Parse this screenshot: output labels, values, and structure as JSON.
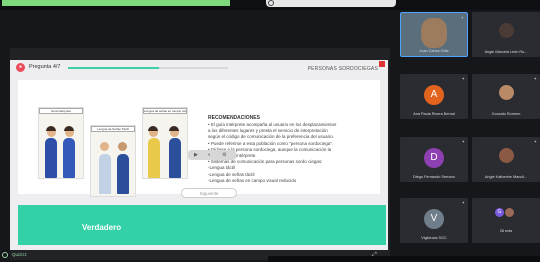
{
  "quiz": {
    "progress_label": "Pregunta 4/7",
    "progress_fraction": 0.571,
    "section_title": "PERSONAS SORDOCIEGAS",
    "answer_label": "Verdadero",
    "next_button": "Siguiente",
    "images": [
      {
        "caption": "Guía intérprete"
      },
      {
        "caption": "Lengua de Señas Táctil"
      },
      {
        "caption": "Lengua de señas en campo visual reducido"
      }
    ],
    "recommendations_title": "RECOMENDACIONES",
    "recommendations": [
      "• El guía intérprete acompaña al usuario en los desplazamientos",
      "  a los diferentes lugares y presta el servicio de interpretación",
      "  según el código de comunicación de la preferencia del usuario.",
      "• Puede referirse a esta población como \"persona sordociega\".",
      "• Diríjase a la persona sordociega, aunque la comunicación la",
      "  medie el guía intérprete.",
      "• Sistemas de comunicación para personas sordo ciegas:",
      "  -Lengua táctil",
      "  -Lengua de señas táctil",
      "  -Lengua de señas en campo visual reducido"
    ],
    "brand": "Quizizz",
    "accent": "#34d0a7",
    "pill_icon": "record-icon"
  },
  "participants": [
    {
      "name": "Juan Carlos Ortiz",
      "avatar": "photo",
      "speaker": true
    },
    {
      "name": "Angie Marcela León Ru...",
      "avatar": "photo"
    },
    {
      "name": "Ana Paola Rivera Bernal",
      "initial": "A",
      "color": "#e2631e"
    },
    {
      "name": "Gonzalo Romero",
      "avatar": "photo"
    },
    {
      "name": "Diego Fernando Serrano",
      "initial": "D",
      "color": "#8e3fb2"
    },
    {
      "name": "Angie Katherine Mancil...",
      "avatar": "photo"
    },
    {
      "name": "Vigilancia SGC",
      "initial": "V",
      "color": "#6f7e8a"
    },
    {
      "name": "28 más",
      "initial": "G",
      "color": "#7a5ae0"
    }
  ]
}
